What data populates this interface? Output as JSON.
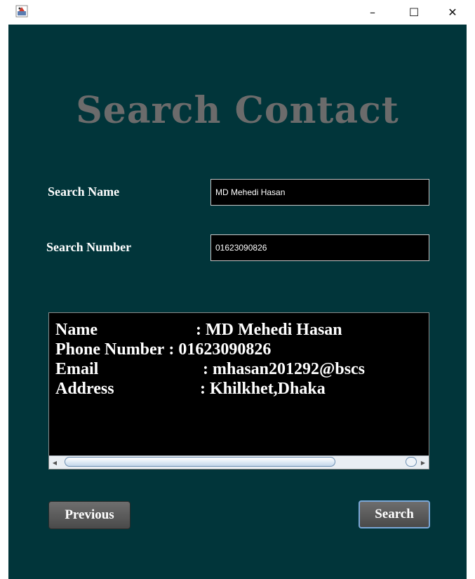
{
  "window": {
    "minimize": "–",
    "maximize": "☐",
    "close": "✕"
  },
  "title": "Search Contact",
  "form": {
    "name_label": "Search Name",
    "name_value": "MD Mehedi Hasan",
    "number_label": "Search Number",
    "number_value": "01623090826"
  },
  "result": {
    "rows": [
      {
        "key": "Name",
        "sep": ": MD Mehedi Hasan"
      },
      {
        "key": "Phone Number",
        "sep": ": 01623090826"
      },
      {
        "key": "Email",
        "sep": ": mhasan201292@bscs"
      },
      {
        "key": "Address",
        "sep": ": Khilkhet,Dhaka"
      }
    ]
  },
  "buttons": {
    "previous": "Previous",
    "search": "Search"
  },
  "colors": {
    "panel": "#01353a",
    "title": "#6b6b6b",
    "field_bg": "#000000"
  }
}
